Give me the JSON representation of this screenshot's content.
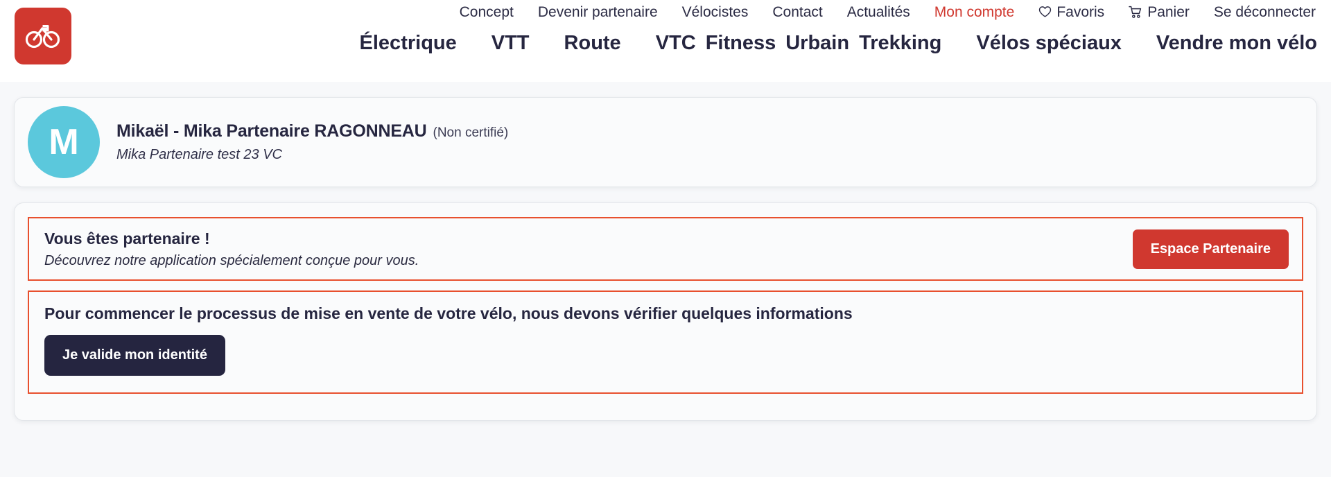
{
  "brand": {
    "logo_icon": "bicycle-infinity-logo",
    "logo_bg": "#d0382f"
  },
  "header": {
    "top_nav": [
      {
        "label": "Concept",
        "icon": null,
        "active": false
      },
      {
        "label": "Devenir partenaire",
        "icon": null,
        "active": false
      },
      {
        "label": "Vélocistes",
        "icon": null,
        "active": false
      },
      {
        "label": "Contact",
        "icon": null,
        "active": false
      },
      {
        "label": "Actualités",
        "icon": null,
        "active": false
      },
      {
        "label": "Mon compte",
        "icon": null,
        "active": true
      },
      {
        "label": "Favoris",
        "icon": "heart-icon",
        "active": false
      },
      {
        "label": "Panier",
        "icon": "cart-icon",
        "active": false
      },
      {
        "label": "Se déconnecter",
        "icon": null,
        "active": false
      }
    ],
    "main_nav": [
      "Électrique",
      "VTT",
      "Route",
      "VTC",
      "Fitness",
      "Urbain",
      "Trekking",
      "Vélos spéciaux",
      "Vendre mon vélo"
    ],
    "active_color": "#d0382f"
  },
  "profile": {
    "avatar_initial": "M",
    "avatar_color": "#5bc8dc",
    "name": "Mikaël - Mika Partenaire RAGONNEAU",
    "certification": "(Non certifié)",
    "subtitle": "Mika Partenaire test 23 VC"
  },
  "partner_alert": {
    "title": "Vous êtes partenaire !",
    "subtitle": "Découvrez notre application spécialement conçue pour vous.",
    "button_label": "Espace Partenaire",
    "button_color": "#d0382f",
    "border_color": "#e8502e"
  },
  "verify_alert": {
    "title": "Pour commencer le processus de mise en vente de votre vélo, nous devons vérifier quelques informations",
    "button_label": "Je valide mon identité",
    "button_color": "#252540",
    "border_color": "#e8502e"
  }
}
